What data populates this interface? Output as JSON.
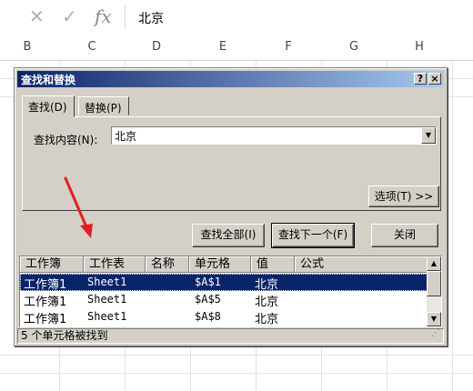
{
  "formula_bar": {
    "cancel_icon": "close-icon",
    "enter_icon": "check-icon",
    "fx_label": "fx",
    "value": "北京"
  },
  "columns": [
    "B",
    "C",
    "D",
    "E",
    "F",
    "G",
    "H"
  ],
  "dialog": {
    "title": "查找和替换",
    "help_label": "?",
    "close_label": "×",
    "tabs": [
      {
        "label": "查找(D)"
      },
      {
        "label": "替换(P)"
      }
    ],
    "find_label": "查找内容(N):",
    "find_value": "北京",
    "options_label": "选项(T) >>",
    "buttons": {
      "find_all": "查找全部(I)",
      "find_next": "查找下一个(F)",
      "close": "关闭"
    },
    "results": {
      "headers": [
        "工作簿",
        "工作表",
        "名称",
        "单元格",
        "值",
        "公式"
      ],
      "rows": [
        [
          "工作簿1",
          "Sheet1",
          "",
          "$A$1",
          "北京",
          ""
        ],
        [
          "工作簿1",
          "Sheet1",
          "",
          "$A$5",
          "北京",
          ""
        ],
        [
          "工作簿1",
          "Sheet1",
          "",
          "$A$8",
          "北京",
          ""
        ]
      ]
    },
    "status": "5 个单元格被找到"
  },
  "colors": {
    "title_gradient_start": "#0a246a",
    "title_gradient_end": "#a6caf0",
    "dialog_face": "#d4d0c8",
    "selection": "#0a246a",
    "annotation_arrow": "#e02020"
  }
}
